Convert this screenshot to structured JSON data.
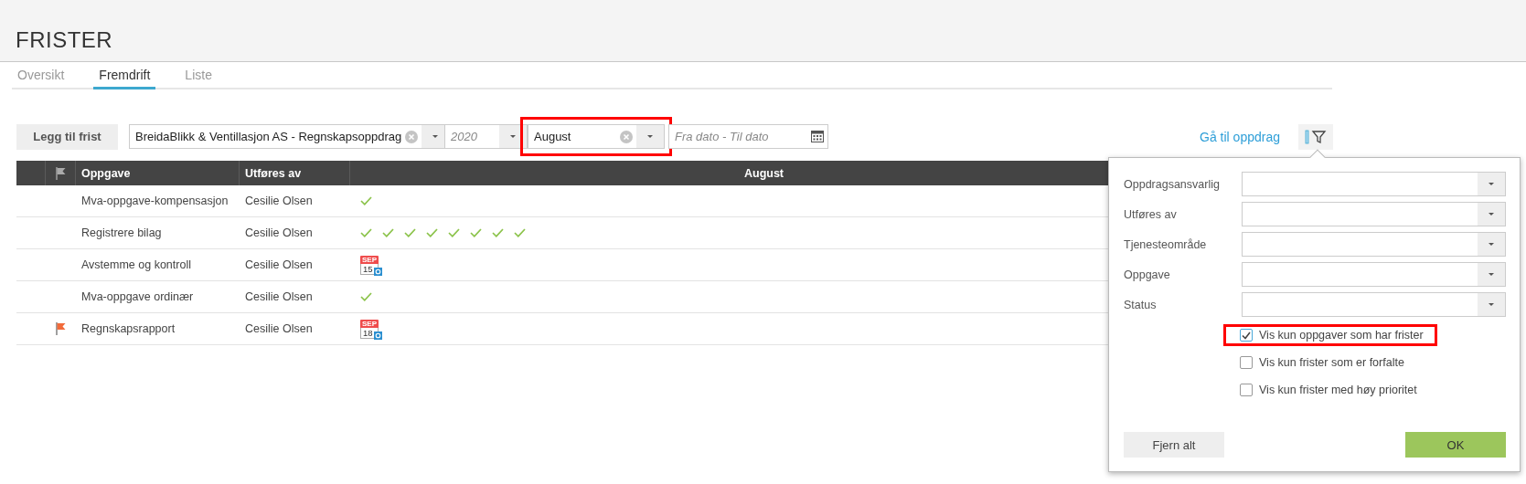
{
  "page": {
    "title": "FRISTER"
  },
  "tabs": [
    {
      "label": "Oversikt",
      "selected": false
    },
    {
      "label": "Fremdrift",
      "selected": true
    },
    {
      "label": "Liste",
      "selected": false
    }
  ],
  "toolbar": {
    "add_button": "Legg til frist",
    "client_select": {
      "value": "BreidaBlikk & Ventillasjon AS - Regnskapsoppdrag",
      "clearable": true,
      "highlighted": false
    },
    "year_select": {
      "placeholder": "2020",
      "clearable": false,
      "highlighted": false
    },
    "month_select": {
      "value": "August",
      "clearable": true,
      "highlighted": true
    },
    "date_range": {
      "placeholder": "Fra dato - Til dato"
    },
    "link": "Gå til oppdrag"
  },
  "table": {
    "columns": [
      "Oppgave",
      "Utføres av",
      "August"
    ],
    "rows": [
      {
        "flagged": false,
        "task": "Mva-oppgave-kompensasjon",
        "assignee": "Cesilie Olsen",
        "marks": [
          {
            "kind": "check"
          }
        ]
      },
      {
        "flagged": false,
        "task": "Registrere bilag",
        "assignee": "Cesilie Olsen",
        "marks": [
          {
            "kind": "check"
          },
          {
            "kind": "check"
          },
          {
            "kind": "check"
          },
          {
            "kind": "check"
          },
          {
            "kind": "check"
          },
          {
            "kind": "check"
          },
          {
            "kind": "check"
          },
          {
            "kind": "check"
          }
        ]
      },
      {
        "flagged": false,
        "task": "Avstemme og kontroll",
        "assignee": "Cesilie Olsen",
        "marks": [
          {
            "kind": "calendar",
            "month": "SEP",
            "day": "15"
          }
        ]
      },
      {
        "flagged": false,
        "task": "Mva-oppgave ordinær",
        "assignee": "Cesilie Olsen",
        "marks": [
          {
            "kind": "check"
          }
        ]
      },
      {
        "flagged": true,
        "task": "Regnskapsrapport",
        "assignee": "Cesilie Olsen",
        "marks": [
          {
            "kind": "calendar",
            "month": "SEP",
            "day": "18"
          }
        ]
      }
    ]
  },
  "filter_panel": {
    "fields": [
      {
        "label": "Oppdragsansvarlig"
      },
      {
        "label": "Utføres av"
      },
      {
        "label": "Tjenesteområde"
      },
      {
        "label": "Oppgave"
      },
      {
        "label": "Status"
      }
    ],
    "options": [
      {
        "label": "Vis kun oppgaver som har frister",
        "checked": true,
        "highlighted": true
      },
      {
        "label": "Vis kun frister som er forfalte",
        "checked": false,
        "highlighted": false
      },
      {
        "label": "Vis kun frister med høy prioritet",
        "checked": false,
        "highlighted": false
      }
    ],
    "clear_button": "Fjern alt",
    "ok_button": "OK"
  }
}
